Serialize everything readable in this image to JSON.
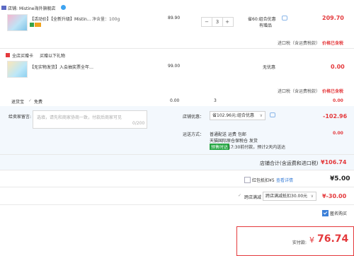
{
  "shop": {
    "label": "店铺:",
    "name": "Mistine海外旗舰店"
  },
  "item1": {
    "title": "【活动价】【全新升级】Mistin…",
    "spec": "净含量：100g",
    "price": "89.90",
    "qty": "3",
    "promo": "省60:组合优惠",
    "promo_sub": "有赠品",
    "subtotal": "209.70",
    "tax_label": "进口税（含运费税款）",
    "tax_value": "价格已含税"
  },
  "gift_section": {
    "title": "全店买赠卡 不…",
    "gift_label": "全店买赠卡",
    "gift_hint": "买赠以下礼物"
  },
  "item2": {
    "title": "【无实物发货】入会抽奖票全年…",
    "price": "99.00",
    "promo": "无优惠",
    "subtotal": "0.00",
    "tax_label": "进口税（含运费税款）",
    "tax_value": "价格已含税"
  },
  "shipping_insurance": {
    "label": "退货宝",
    "option": "免费",
    "price": "0.00",
    "qty": "3",
    "subtotal": "0.00"
  },
  "buyer_message": {
    "label": "给卖家留言:",
    "placeholder": "选填，请先和商家协商一致，付款后商家可见",
    "counter": "0/200"
  },
  "shop_discount": {
    "label": "店铺优惠：",
    "select": "省102.96元:组合优惠",
    "amount": "-102.96"
  },
  "delivery": {
    "label": "运送方式：",
    "method": "普通配送 运费 包邮",
    "line2": "天猫国际原仓保税仓 发货",
    "badge": "预售时达",
    "line3": "17:30前付款，预计2天内送达",
    "amount": "0.00"
  },
  "shop_total": {
    "label": "店铺合计(含运费和进口税)",
    "value": "¥106.74"
  },
  "red_packet": {
    "label": "红包抵扣¥5",
    "link": "查看详情",
    "amount": "¥5.00"
  },
  "cross_store": {
    "label": "跨店满减",
    "select": "跨店满减抵扣30.00元",
    "amount": "¥-30.00"
  },
  "anonymous": {
    "label": "匿名购买"
  },
  "payment": {
    "label": "实付款:",
    "currency": "¥",
    "value": "76.74"
  }
}
